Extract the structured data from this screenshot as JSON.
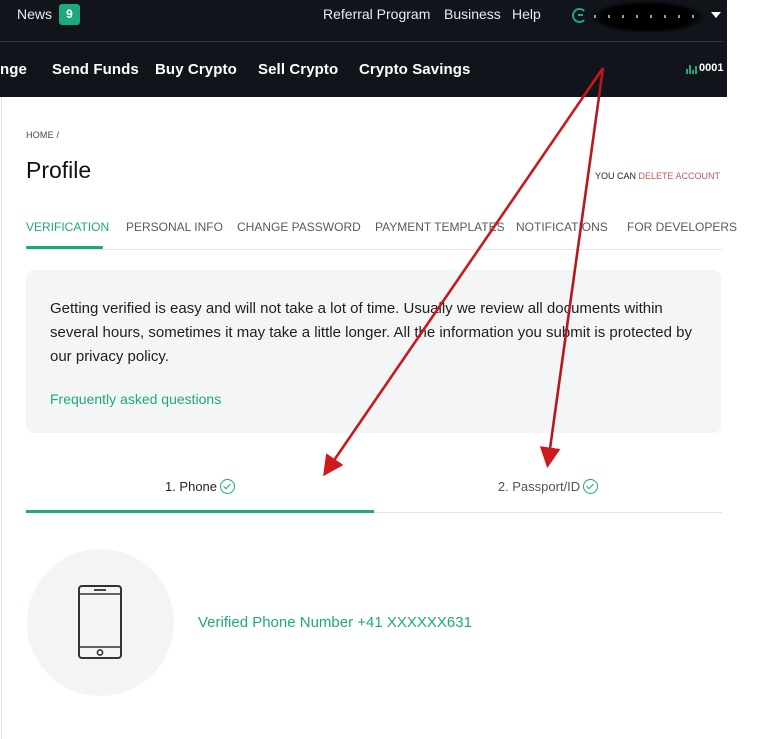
{
  "header": {
    "top": {
      "news_label": "News",
      "news_count": "9",
      "links": [
        "Referral Program",
        "Business",
        "Help"
      ],
      "user_name": "(redacted)"
    },
    "nav": {
      "items": [
        "nge",
        "Send Funds",
        "Buy Crypto",
        "Sell Crypto",
        "Crypto Savings"
      ],
      "rank_value": "0001"
    }
  },
  "page": {
    "breadcrumb": "HOME /",
    "title": "Profile",
    "delete_prefix": "YOU CAN",
    "delete_link": "DELETE ACCOUNT",
    "tabs": [
      {
        "label": "VERIFICATION",
        "active": true
      },
      {
        "label": "PERSONAL INFO",
        "active": false
      },
      {
        "label": "CHANGE PASSWORD",
        "active": false
      },
      {
        "label": "PAYMENT TEMPLATES",
        "active": false
      },
      {
        "label": "NOTIFICATIONS",
        "active": false
      },
      {
        "label": "FOR DEVELOPERS",
        "active": false
      }
    ],
    "info": {
      "text": "Getting verified is easy and will not take a lot of time. Usually we review all documents within several hours, sometimes it may take a little longer. All the information you submit is protected by our privacy policy.",
      "faq_link": "Frequently asked questions"
    },
    "steps": [
      {
        "label": "1. Phone",
        "verified": true,
        "active": true
      },
      {
        "label": "2. Passport/ID",
        "verified": true,
        "active": false
      }
    ],
    "phone_status": "Verified Phone Number +41 XXXXXX631"
  },
  "colors": {
    "accent": "#1ea97c",
    "header_bg": "#11141b",
    "danger_link": "#c05a55",
    "annotation_arrow": "#d0191c"
  },
  "annotations": {
    "arrow_count": 2
  }
}
